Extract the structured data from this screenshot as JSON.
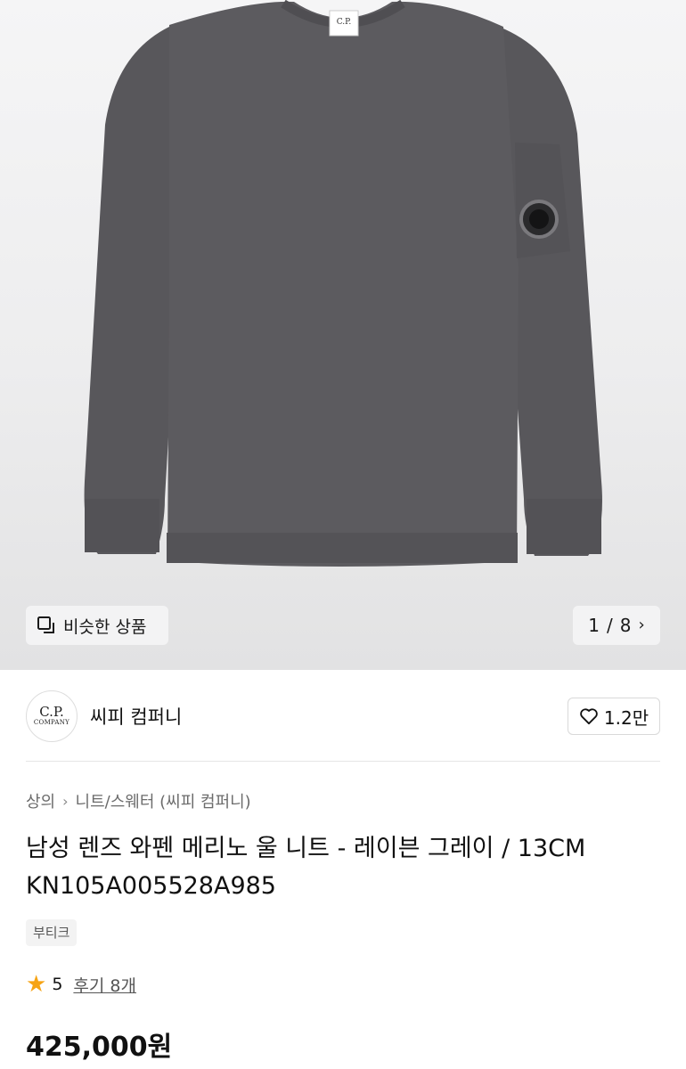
{
  "hero": {
    "similar_label": "비슷한 상품",
    "pager_current": "1",
    "pager_sep": "/",
    "pager_total": "8"
  },
  "brand": {
    "logo_line1": "C.P.",
    "logo_line2": "COMPANY",
    "name": "씨피 컴퍼니",
    "likes": "1.2만"
  },
  "breadcrumb": {
    "level1": "상의",
    "level2": "니트/스웨터 (씨피 컴퍼니)"
  },
  "product": {
    "title_line1": "남성 렌즈 와펜 메리노 울 니트 - 레이븐 그레이 / 13CM",
    "title_line2": "KN105A005528A985",
    "tag": "부티크",
    "rating": "5",
    "reviews": "후기 8개",
    "price": "425,000원"
  },
  "colors": {
    "sweater": "#5b5a5e",
    "star": "#f6a313"
  }
}
